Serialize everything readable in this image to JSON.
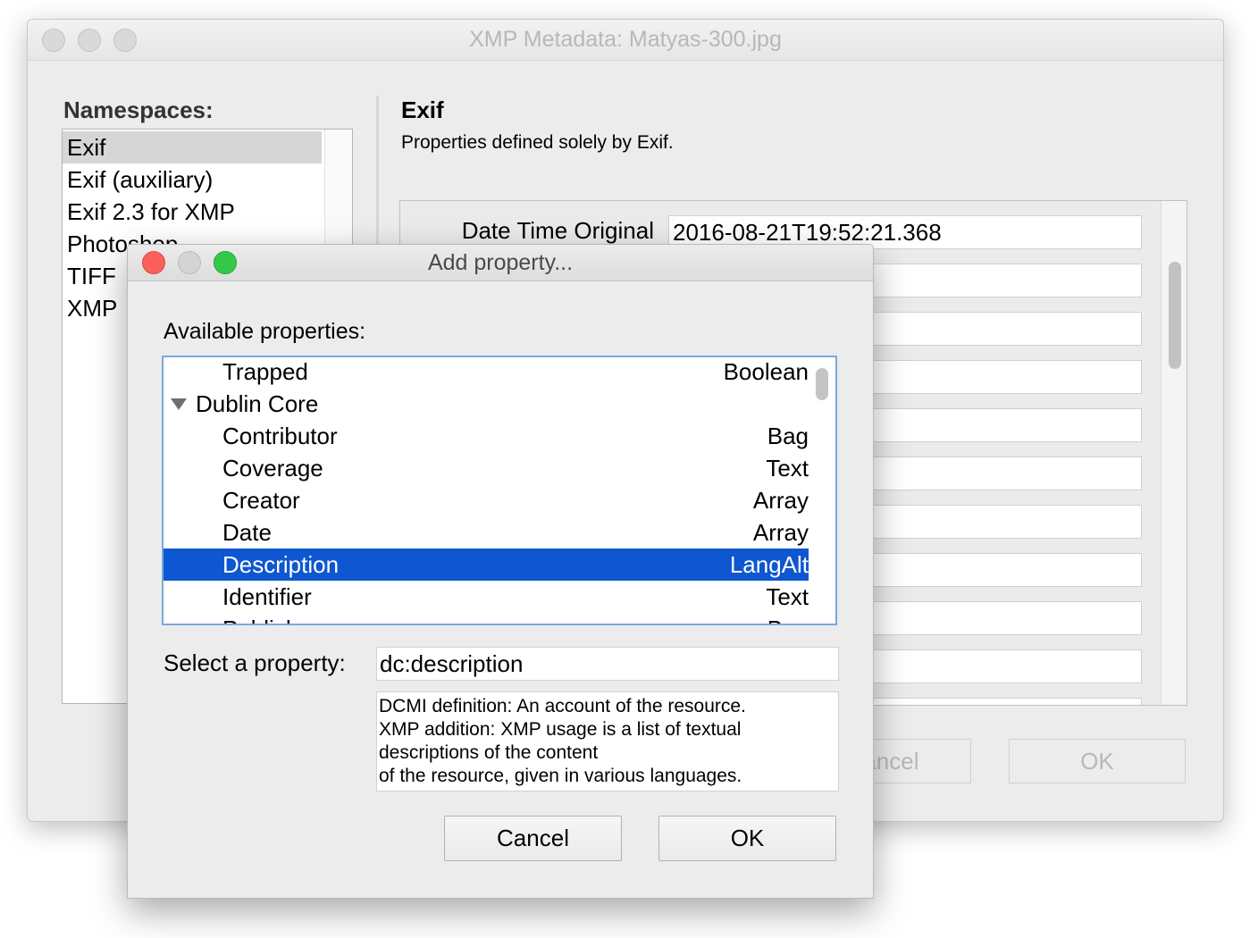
{
  "back_window": {
    "title": "XMP Metadata: Matyas-300.jpg",
    "namespaces_label": "Namespaces:",
    "namespaces": [
      "Exif",
      "Exif (auxiliary)",
      "Exif 2.3 for XMP",
      "Photoshop",
      "TIFF",
      "XMP"
    ],
    "selected_namespace": "Exif",
    "section_title": "Exif",
    "section_description": "Properties defined solely by Exif.",
    "properties": [
      {
        "label": "Date Time Original",
        "value": "2016-08-21T19:52:21.368"
      }
    ],
    "cancel_label": "Cancel",
    "ok_label": "OK"
  },
  "dialog": {
    "title": "Add property...",
    "available_label": "Available properties:",
    "rows": [
      {
        "name": "Trapped",
        "type": "Boolean"
      },
      {
        "name": "Dublin Core",
        "type": "",
        "group": true
      },
      {
        "name": "Contributor",
        "type": "Bag"
      },
      {
        "name": "Coverage",
        "type": "Text"
      },
      {
        "name": "Creator",
        "type": "Array"
      },
      {
        "name": "Date",
        "type": "Array"
      },
      {
        "name": "Description",
        "type": "LangAlt",
        "selected": true
      },
      {
        "name": "Identifier",
        "type": "Text"
      },
      {
        "name": "Publisher",
        "type": "Bag"
      }
    ],
    "select_label": "Select a property:",
    "select_value": "dc:description",
    "description_lines": [
      "DCMI definition: An account of the resource.",
      "XMP addition: XMP usage is a list of textual",
      "descriptions of the content",
      "of the resource, given in various languages."
    ],
    "cancel_label": "Cancel",
    "ok_label": "OK"
  },
  "colors": {
    "selection": "#0e57d0",
    "close_light": "#fc605b",
    "zoom_light": "#34c84a"
  }
}
